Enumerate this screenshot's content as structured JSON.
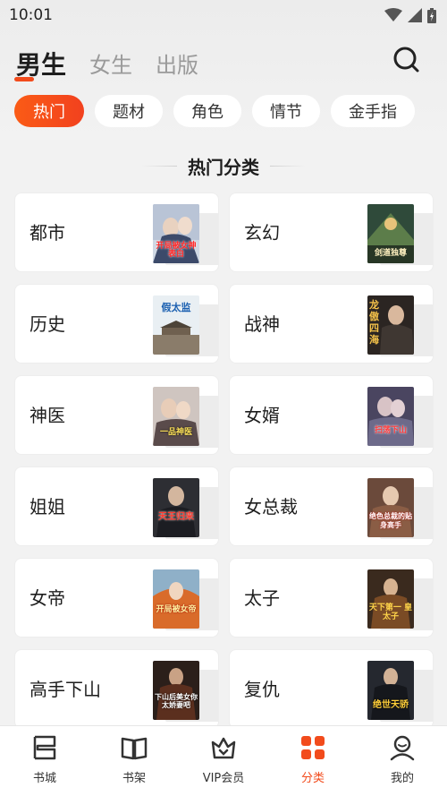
{
  "status_bar": {
    "time": "10:01"
  },
  "gender_tabs": [
    {
      "label": "男生",
      "active": true
    },
    {
      "label": "女生",
      "active": false
    },
    {
      "label": "出版",
      "active": false
    }
  ],
  "chips": [
    {
      "label": "热门",
      "active": true
    },
    {
      "label": "题材",
      "active": false
    },
    {
      "label": "角色",
      "active": false
    },
    {
      "label": "情节",
      "active": false
    },
    {
      "label": "金手指",
      "active": false
    }
  ],
  "section_title": "热门分类",
  "categories": [
    {
      "label": "都市",
      "cover_text": "开局被女神表白"
    },
    {
      "label": "玄幻",
      "cover_text": "剑道独尊"
    },
    {
      "label": "历史",
      "cover_text": "假太监"
    },
    {
      "label": "战神",
      "cover_text": "龙傲四海"
    },
    {
      "label": "神医",
      "cover_text": "一品神医"
    },
    {
      "label": "女婿",
      "cover_text": "扫荡下山"
    },
    {
      "label": "姐姐",
      "cover_text": "天王归来"
    },
    {
      "label": "女总裁",
      "cover_text": "绝色总裁的贴身高手"
    },
    {
      "label": "女帝",
      "cover_text": "开局被女帝"
    },
    {
      "label": "太子",
      "cover_text": "天下第一 皇太子"
    },
    {
      "label": "高手下山",
      "cover_text": "下山后美女你太娇妻吧"
    },
    {
      "label": "复仇",
      "cover_text": "绝世天骄"
    }
  ],
  "bottom_nav": [
    {
      "label": "书城",
      "icon": "bookstore-icon",
      "active": false
    },
    {
      "label": "书架",
      "icon": "bookshelf-icon",
      "active": false
    },
    {
      "label": "VIP会员",
      "icon": "vip-crown-icon",
      "active": false
    },
    {
      "label": "分类",
      "icon": "category-grid-icon",
      "active": true
    },
    {
      "label": "我的",
      "icon": "profile-icon",
      "active": false
    }
  ],
  "colors": {
    "accent": "#f24b1c",
    "background": "#f2f2f2"
  }
}
